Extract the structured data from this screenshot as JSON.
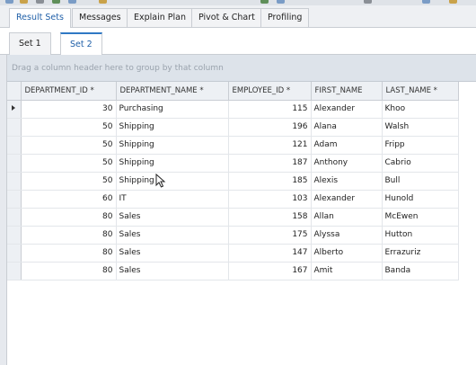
{
  "result_tabs": [
    {
      "label": "Result Sets",
      "active": true
    },
    {
      "label": "Messages",
      "active": false
    },
    {
      "label": "Explain Plan",
      "active": false
    },
    {
      "label": "Pivot & Chart",
      "active": false
    },
    {
      "label": "Profiling",
      "active": false
    }
  ],
  "set_tabs": [
    {
      "label": "Set 1",
      "active": false
    },
    {
      "label": "Set 2",
      "active": true
    }
  ],
  "group_hint": "Drag a column header here to group by that column",
  "grid": {
    "columns": [
      "DEPARTMENT_ID *",
      "DEPARTMENT_NAME *",
      "EMPLOYEE_ID *",
      "FIRST_NAME",
      "LAST_NAME *"
    ],
    "rows": [
      [
        "30",
        "Purchasing",
        "115",
        "Alexander",
        "Khoo"
      ],
      [
        "50",
        "Shipping",
        "196",
        "Alana",
        "Walsh"
      ],
      [
        "50",
        "Shipping",
        "121",
        "Adam",
        "Fripp"
      ],
      [
        "50",
        "Shipping",
        "187",
        "Anthony",
        "Cabrio"
      ],
      [
        "50",
        "Shipping",
        "185",
        "Alexis",
        "Bull"
      ],
      [
        "60",
        "IT",
        "103",
        "Alexander",
        "Hunold"
      ],
      [
        "80",
        "Sales",
        "158",
        "Allan",
        "McEwen"
      ],
      [
        "80",
        "Sales",
        "175",
        "Alyssa",
        "Hutton"
      ],
      [
        "80",
        "Sales",
        "147",
        "Alberto",
        "Errazuriz"
      ],
      [
        "80",
        "Sales",
        "167",
        "Amit",
        "Banda"
      ]
    ],
    "current_row": 0
  }
}
